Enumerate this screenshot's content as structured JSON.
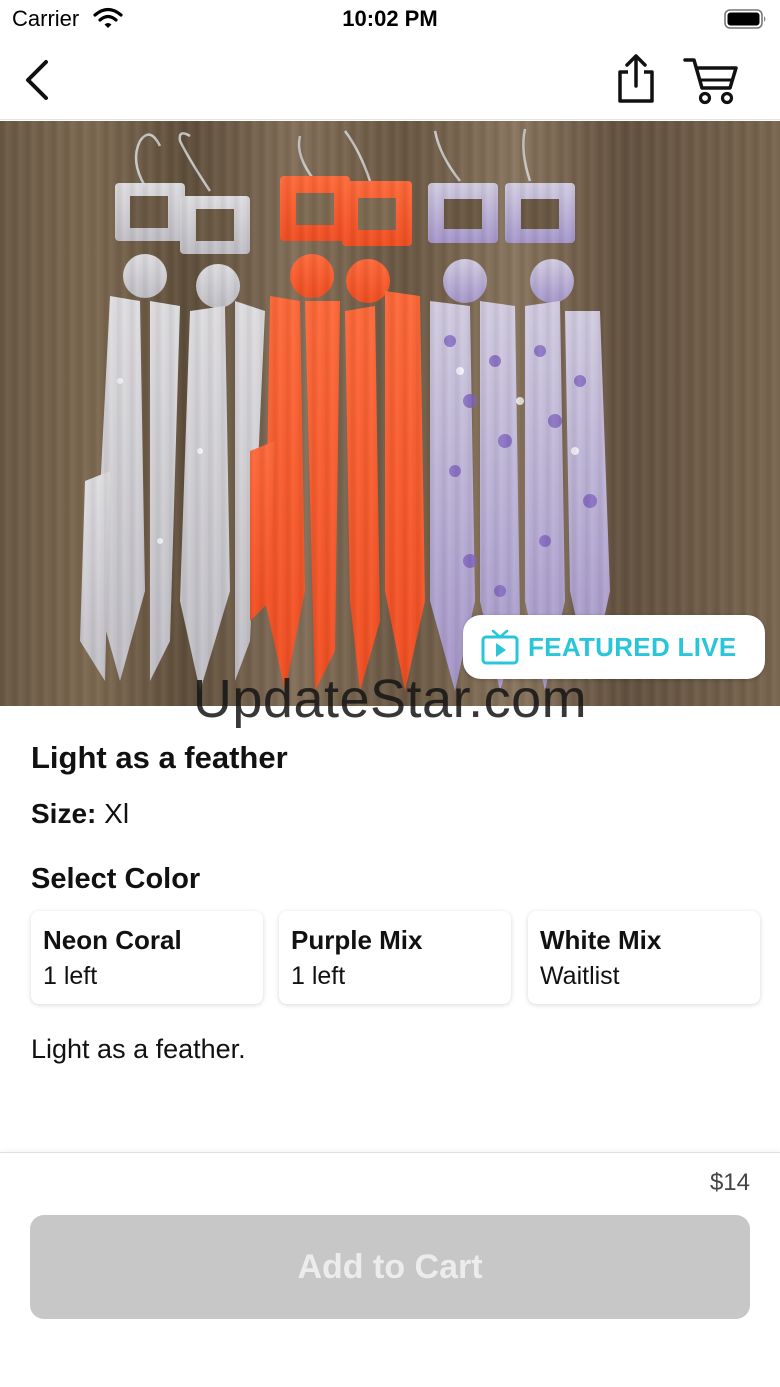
{
  "status_bar": {
    "carrier": "Carrier",
    "time": "10:02 PM"
  },
  "nav": {
    "back_icon": "chevron-left-icon",
    "share_icon": "share-icon",
    "cart_icon": "cart-icon"
  },
  "product": {
    "title": "Light as a feather",
    "size_label": "Size:",
    "size_value": "Xl",
    "select_color_heading": "Select Color",
    "colors": [
      {
        "name": "Neon Coral",
        "stock": "1 left"
      },
      {
        "name": "Purple Mix",
        "stock": "1 left"
      },
      {
        "name": "White Mix",
        "stock": "Waitlist"
      }
    ],
    "description": "Light as a feather.",
    "price": "$14"
  },
  "badge": {
    "label": "FEATURED LIVE",
    "icon": "tv-play-icon",
    "color": "#29c5d9"
  },
  "watermark": "UpdateStar.com",
  "cart_button": {
    "label": "Add to Cart",
    "disabled": true
  }
}
